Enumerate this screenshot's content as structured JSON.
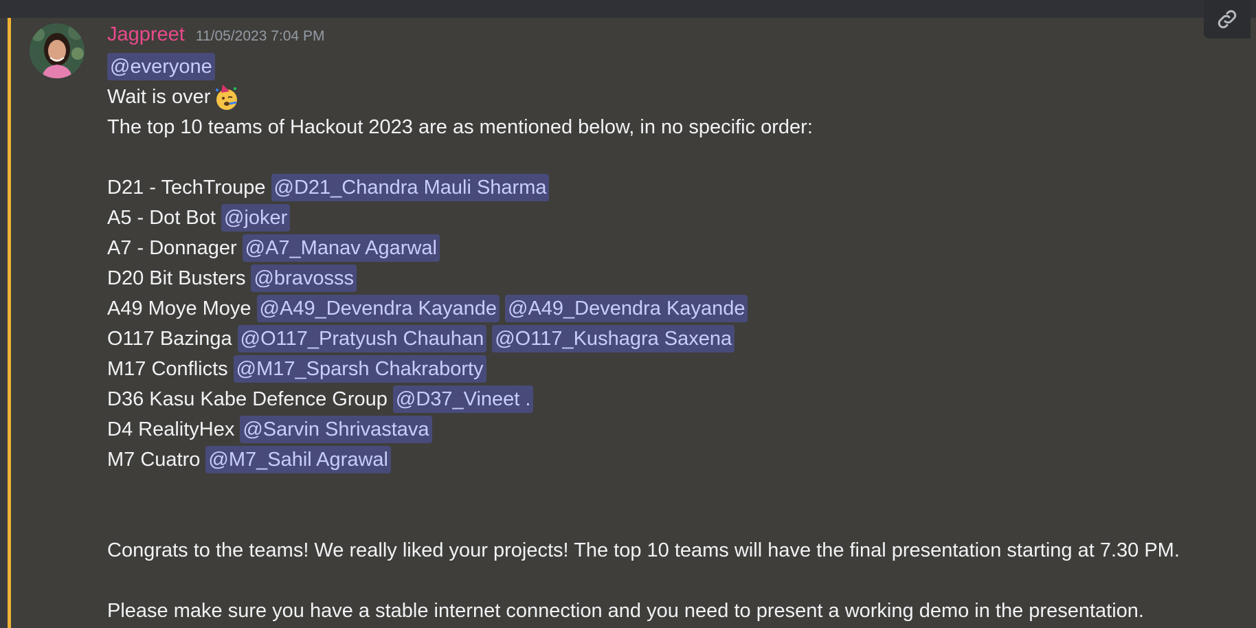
{
  "message": {
    "author": "Jagpreet",
    "timestamp": "11/05/2023 7:04 PM",
    "author_color": "#e84a8a",
    "mention_everyone": "@everyone",
    "wait_text": "Wait is over",
    "emoji_name": "partying-face-emoji",
    "intro": "The top 10 teams of Hackout 2023 are as mentioned below, in no specific order:",
    "teams": [
      {
        "label": "D21 - TechTroupe",
        "mentions": [
          "@D21_Chandra Mauli Sharma"
        ]
      },
      {
        "label": "A5 - Dot Bot",
        "mentions": [
          "@joker"
        ]
      },
      {
        "label": "A7 - Donnager",
        "mentions": [
          "@A7_Manav Agarwal"
        ]
      },
      {
        "label": "D20 Bit Busters",
        "mentions": [
          "@bravosss"
        ]
      },
      {
        "label": "A49 Moye Moye",
        "mentions": [
          "@A49_Devendra Kayande",
          "@A49_Devendra Kayande"
        ]
      },
      {
        "label": "O117 Bazinga",
        "mentions": [
          "@O117_Pratyush Chauhan",
          "@O117_Kushagra Saxena"
        ]
      },
      {
        "label": "M17 Conflicts",
        "mentions": [
          "@M17_Sparsh Chakraborty"
        ]
      },
      {
        "label": "D36 Kasu Kabe Defence Group",
        "mentions": [
          "@D37_Vineet ."
        ]
      },
      {
        "label": "D4 RealityHex",
        "mentions": [
          "@Sarvin Shrivastava"
        ]
      },
      {
        "label": "M7 Cuatro",
        "mentions": [
          "@M7_Sahil Agrawal"
        ]
      }
    ],
    "congrats": "Congrats to the teams! We really liked your projects! The top 10 teams will have the final presentation starting at 7.30 PM.",
    "reminder": "Please make sure you have a stable internet connection and you need to present a working demo in the presentation."
  },
  "toolbar": {
    "icon": "link-icon"
  },
  "colors": {
    "highlight_bar": "#f0b232",
    "mention_bg": "#5865f2",
    "background": "#3f3e3b"
  }
}
